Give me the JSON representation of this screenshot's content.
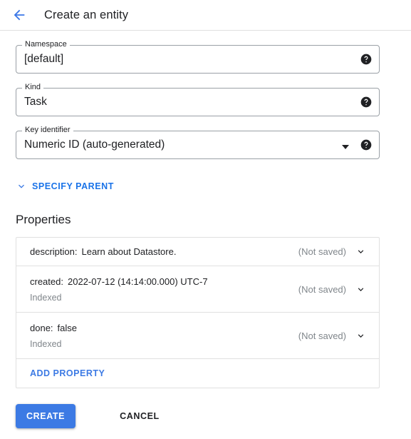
{
  "header": {
    "back_icon": "arrow-left-icon",
    "title": "Create an entity"
  },
  "form": {
    "fields": [
      {
        "label": "Namespace",
        "value": "[default]",
        "help_icon": "help-icon",
        "has_dropdown": false
      },
      {
        "label": "Kind",
        "value": "Task",
        "help_icon": "help-icon",
        "has_dropdown": false
      },
      {
        "label": "Key identifier",
        "value": "Numeric ID (auto-generated)",
        "help_icon": "help-icon",
        "has_dropdown": true
      }
    ],
    "specify_parent": {
      "label": "SPECIFY PARENT",
      "icon": "chevron-down-icon"
    }
  },
  "properties": {
    "title": "Properties",
    "rows": [
      {
        "key": "description:",
        "value": "Learn about Datastore.",
        "sub": "",
        "status": "(Not saved)",
        "chevron": "chevron-down-icon"
      },
      {
        "key": "created:",
        "value": "2022-07-12 (14:14:00.000) UTC-7",
        "sub": "Indexed",
        "status": "(Not saved)",
        "chevron": "chevron-down-icon"
      },
      {
        "key": "done:",
        "value": "false",
        "sub": "Indexed",
        "status": "(Not saved)",
        "chevron": "chevron-down-icon"
      }
    ],
    "add_property_label": "ADD PROPERTY"
  },
  "actions": {
    "create_label": "CREATE",
    "cancel_label": "CANCEL"
  },
  "colors": {
    "accent_blue": "#3c7ae4",
    "link_blue": "#1a73e8",
    "text_primary": "#202124",
    "text_secondary": "#80868b",
    "border": "#e0e0e0",
    "field_border": "#9aa0a6"
  }
}
